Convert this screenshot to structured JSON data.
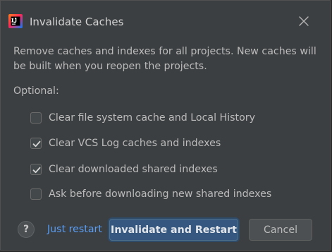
{
  "window": {
    "title": "Invalidate Caches",
    "app_icon": "intellij-idea-icon",
    "close_icon": "close-icon"
  },
  "message": "Remove caches and indexes for all projects. New caches will be built when you reopen the projects.",
  "optional_label": "Optional:",
  "options": [
    {
      "label": "Clear file system cache and Local History",
      "checked": false
    },
    {
      "label": "Clear VCS Log caches and indexes",
      "checked": true
    },
    {
      "label": "Clear downloaded shared indexes",
      "checked": true
    },
    {
      "label": "Ask before downloading new shared indexes",
      "checked": false
    }
  ],
  "footer": {
    "help_icon": "help-icon",
    "help_glyph": "?",
    "just_restart_label": "Just restart",
    "primary_label": "Invalidate and Restart",
    "cancel_label": "Cancel"
  },
  "colors": {
    "background": "#3c3f41",
    "text": "#bbbbbb",
    "link": "#589df6",
    "primary_button": "#365880",
    "secondary_button": "#4c5052"
  }
}
